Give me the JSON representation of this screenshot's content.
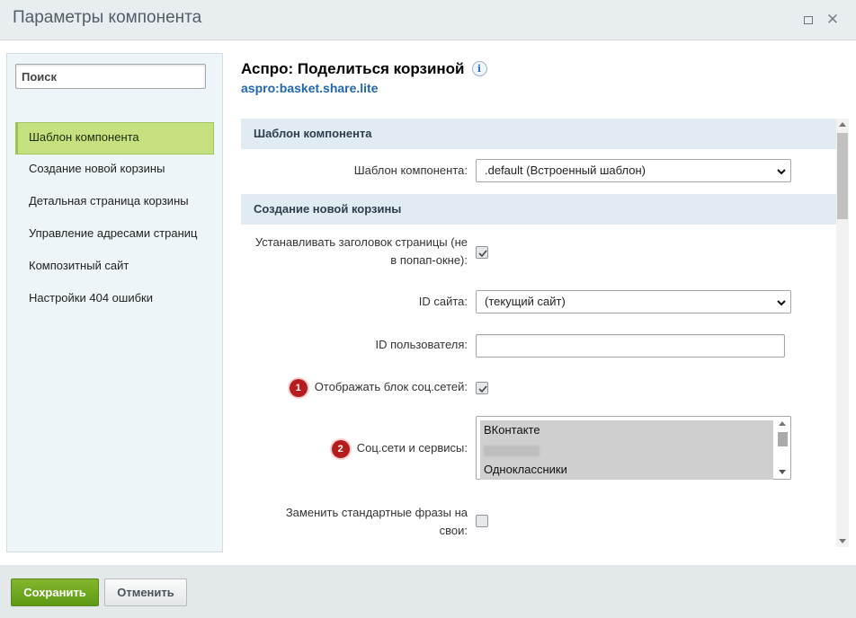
{
  "window": {
    "title": "Параметры компонента",
    "maximize_icon": "maximize-icon",
    "close_icon": "close-icon",
    "close_glyph": "✕"
  },
  "sidebar": {
    "search_placeholder": "Поиск",
    "items": [
      {
        "label": "Шаблон компонента",
        "active": true
      },
      {
        "label": "Создание новой корзины"
      },
      {
        "label": "Детальная страница корзины"
      },
      {
        "label": "Управление адресами страниц"
      },
      {
        "label": "Композитный сайт"
      },
      {
        "label": "Настройки 404 ошибки"
      }
    ]
  },
  "component": {
    "title": "Аспро: Поделиться корзиной",
    "info_glyph": "i",
    "code": "aspro:basket.share.lite"
  },
  "sections": [
    {
      "header": "Шаблон компонента",
      "fields": [
        {
          "label": "Шаблон компонента:",
          "type": "select",
          "value": ".default (Встроенный шаблон)"
        }
      ]
    },
    {
      "header": "Создание новой корзины",
      "fields": [
        {
          "label_line1": "Устанавливать заголовок страницы (не",
          "label_line2": "в попап-окне):",
          "type": "checkbox",
          "checked": true
        },
        {
          "label": "ID сайта:",
          "type": "select",
          "value": "(текущий сайт)"
        },
        {
          "label": "ID пользователя:",
          "type": "text",
          "value": ""
        },
        {
          "label": "Отображать блок соц.сетей:",
          "type": "checkbox",
          "checked": true,
          "badge": "1"
        },
        {
          "label": "Соц.сети и сервисы:",
          "type": "listbox",
          "badge": "2",
          "options": [
            "ВКонтакте",
            "Одноклассники"
          ]
        },
        {
          "label_line1": "Заменить стандартные фразы на",
          "label_line2": "свои:",
          "type": "checkbox",
          "checked": false
        }
      ]
    }
  ],
  "footer": {
    "save_label": "Сохранить",
    "cancel_label": "Отменить"
  },
  "colors": {
    "active_item": "#c5e07f",
    "save_button": "#6fa81f",
    "badge": "#b71c1c",
    "link": "#2067b0"
  }
}
